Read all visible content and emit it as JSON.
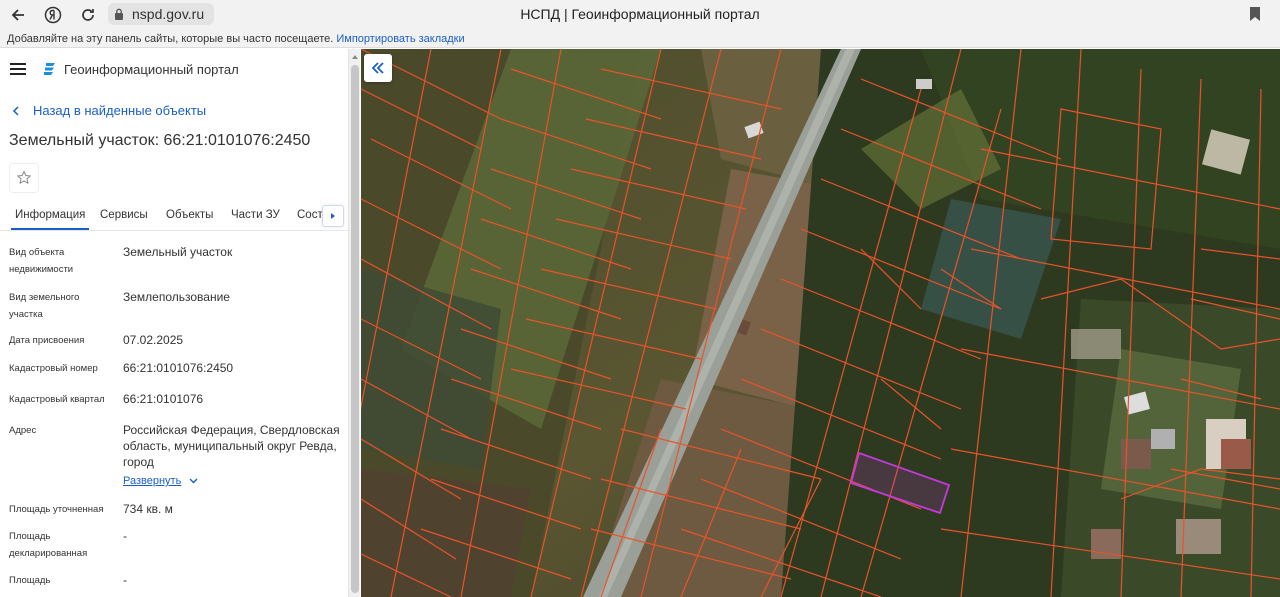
{
  "browser": {
    "url": "nspd.gov.ru",
    "tab_title": "НСПД | Геоинформационный портал",
    "bookmarks_hint": "Добавляйте на эту панель сайты, которые вы часто посещаете.",
    "import_bookmarks": "Импортировать закладки",
    "icons": [
      "back-icon",
      "yandex-icon",
      "reload-icon",
      "lock-icon",
      "bookmark-icon"
    ]
  },
  "app": {
    "title": "Геоинформационный портал",
    "back_link": "Назад в найденные объекты",
    "object_title": "Земельный участок: 66:21:0101076:2450",
    "tabs": [
      {
        "label": "Информация",
        "active": true
      },
      {
        "label": "Сервисы"
      },
      {
        "label": "Объекты"
      },
      {
        "label": "Части ЗУ"
      },
      {
        "label": "Сост"
      }
    ],
    "props": [
      {
        "label": "Вид объекта недвижимости",
        "value": "Земельный участок"
      },
      {
        "label": "Вид земельного участка",
        "value": "Землепользование"
      },
      {
        "label": "Дата присвоения",
        "value": "07.02.2025"
      },
      {
        "label": "Кадастровый номер",
        "value": "66:21:0101076:2450"
      },
      {
        "label": "Кадастровый квартал",
        "value": "66:21:0101076"
      },
      {
        "label": "Адрес",
        "value": "Российская Федерация, Свердловская область, муниципальный округ Ревда, город"
      },
      {
        "label": "Площадь уточненная",
        "value": "734 кв. м"
      },
      {
        "label": "Площадь декларированная",
        "value": "-"
      },
      {
        "label": "Площадь",
        "value": "-"
      }
    ],
    "expand_label": "Развернуть"
  },
  "colors": {
    "link": "#1a5fc8",
    "parcel_border": "#e8532a",
    "selected_parcel": "#c23ad9"
  }
}
